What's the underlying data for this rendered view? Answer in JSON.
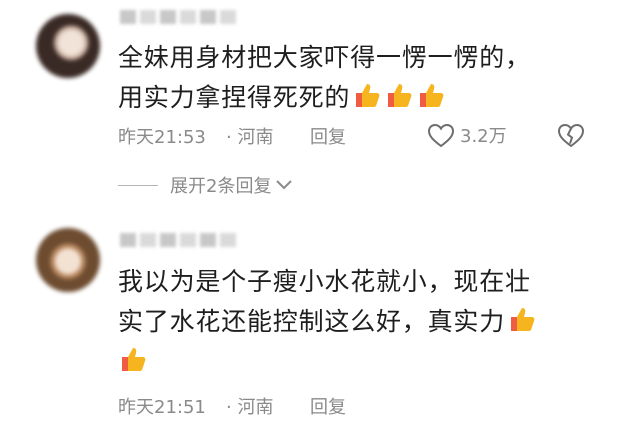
{
  "comments": [
    {
      "username_label": "",
      "text_line1": "全妹用身材把大家吓得一愣一愣的，",
      "text_line2": "用实力拿捏得死死的",
      "thumbs_icon": "thumbs-up-emoji",
      "time": "昨天21:53",
      "location": "· 河南",
      "reply_label": "回复",
      "like_count": "3.2万",
      "expand_label": "展开2条回复"
    },
    {
      "username_label": "",
      "text_line1": "我以为是个子瘦小水花就小，现在壮",
      "text_line2": "实了水花还能控制这么好，真实力",
      "thumbs_icon": "thumbs-up-emoji",
      "time": "昨天21:51",
      "location": "· 河南",
      "reply_label": "回复"
    }
  ],
  "colors": {
    "meta_text": "#8a8a8a",
    "thumb_yellow": "#f6b51e",
    "thumb_red": "#ef5c42"
  }
}
